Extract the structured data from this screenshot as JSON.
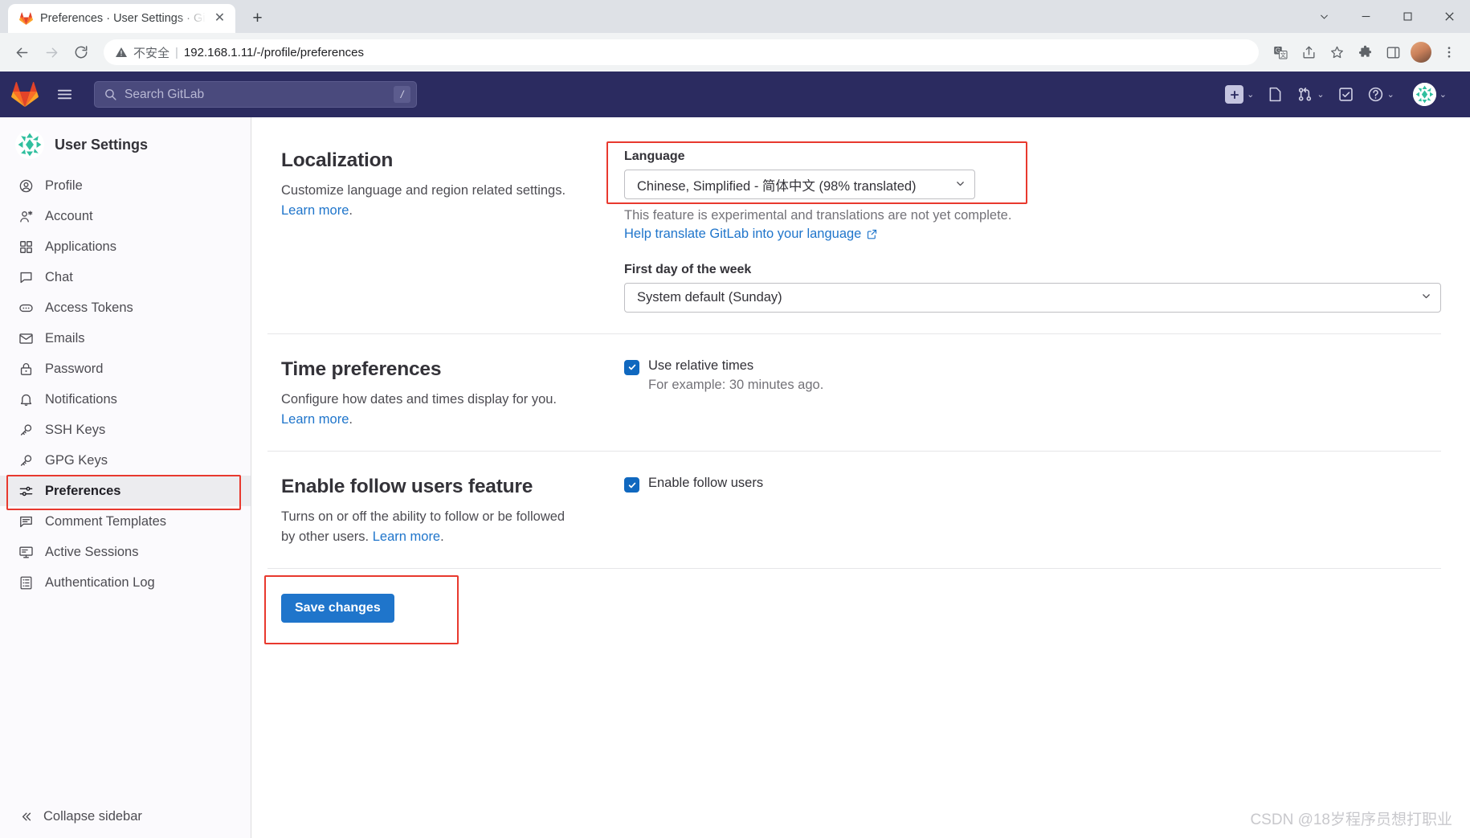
{
  "browser": {
    "tab": {
      "title": "Preferences · User Settings · Gi",
      "favicon": "gitlab-favicon",
      "close": "✕"
    },
    "new_tab": "+",
    "window_controls": {
      "minimize": "minimize-icon",
      "maximize": "maximize-icon",
      "close": "close-icon",
      "chevron": "chevron-down-icon"
    },
    "nav": {
      "back": "back-arrow-icon",
      "forward": "forward-arrow-icon",
      "reload": "reload-icon"
    },
    "omnibox": {
      "warning_icon": "not-secure-warning-icon",
      "warning_text": "不安全",
      "separator": "|",
      "url": "192.168.1.11/-/profile/preferences"
    },
    "toolbar_icons": [
      "translate-icon",
      "share-icon",
      "bookmark-star-icon",
      "extensions-puzzle-icon",
      "side-panel-icon"
    ],
    "profile_avatar": "user-avatar"
  },
  "gitlab_nav": {
    "logo": "gitlab-tanuki-logo",
    "hamburger": "hamburger-menu-icon",
    "search": {
      "placeholder": "Search GitLab",
      "icon": "search-icon",
      "shortcut": "/"
    },
    "right_items": [
      {
        "name": "create-new",
        "icon": "plus-icon",
        "caret": "⌄"
      },
      {
        "name": "issues",
        "icon": "issues-icon",
        "caret": ""
      },
      {
        "name": "merge-requests",
        "icon": "merge-request-icon",
        "caret": "⌄"
      },
      {
        "name": "todos",
        "icon": "todo-check-icon",
        "caret": ""
      },
      {
        "name": "help",
        "icon": "help-question-icon",
        "caret": "⌄"
      }
    ],
    "avatar_caret": "⌄"
  },
  "sidebar": {
    "title": "User Settings",
    "avatar": "user-settings-avatar",
    "items": [
      {
        "label": "Profile",
        "icon": "profile-icon",
        "active": false
      },
      {
        "label": "Account",
        "icon": "account-icon",
        "active": false
      },
      {
        "label": "Applications",
        "icon": "applications-grid-icon",
        "active": false
      },
      {
        "label": "Chat",
        "icon": "chat-bubble-icon",
        "active": false
      },
      {
        "label": "Access Tokens",
        "icon": "access-token-icon",
        "active": false
      },
      {
        "label": "Emails",
        "icon": "envelope-icon",
        "active": false
      },
      {
        "label": "Password",
        "icon": "lock-icon",
        "active": false
      },
      {
        "label": "Notifications",
        "icon": "bell-icon",
        "active": false
      },
      {
        "label": "SSH Keys",
        "icon": "key-icon",
        "active": false
      },
      {
        "label": "GPG Keys",
        "icon": "key-icon",
        "active": false
      },
      {
        "label": "Preferences",
        "icon": "preferences-sliders-icon",
        "active": true
      },
      {
        "label": "Comment Templates",
        "icon": "comment-template-icon",
        "active": false
      },
      {
        "label": "Active Sessions",
        "icon": "monitor-icon",
        "active": false
      },
      {
        "label": "Authentication Log",
        "icon": "log-list-icon",
        "active": false
      }
    ],
    "collapse": {
      "label": "Collapse sidebar",
      "icon": "chevron-double-left-icon"
    }
  },
  "main": {
    "localization": {
      "title": "Localization",
      "desc_text": "Customize language and region related settings. ",
      "desc_link": "Learn more",
      "desc_suffix": ".",
      "language_label": "Language",
      "language_value": "Chinese, Simplified - 简体中文 (98% translated)",
      "language_help": "This feature is experimental and translations are not yet complete.",
      "translate_link": "Help translate GitLab into your language",
      "translate_link_icon": "external-link-icon",
      "week_label": "First day of the week",
      "week_value": "System default (Sunday)"
    },
    "time_preferences": {
      "title": "Time preferences",
      "desc_text": "Configure how dates and times display for you. ",
      "desc_link": "Learn more",
      "desc_suffix": ".",
      "checkbox_label": "Use relative times",
      "checkbox_sub": "For example: 30 minutes ago.",
      "checked": true
    },
    "follow_users": {
      "title": "Enable follow users feature",
      "desc_text": "Turns on or off the ability to follow or be followed by other users. ",
      "desc_link": "Learn more",
      "desc_suffix": ".",
      "checkbox_label": "Enable follow users",
      "checked": true
    },
    "save_button": "Save changes"
  },
  "watermark": "CSDN @18岁程序员想打职业",
  "colors": {
    "gitlab_navy": "#2b2b60",
    "annotation_red": "#e8392e",
    "link_blue": "#1f75cb",
    "button_blue": "#1f75cb",
    "checkbox_blue": "#1068bf"
  }
}
